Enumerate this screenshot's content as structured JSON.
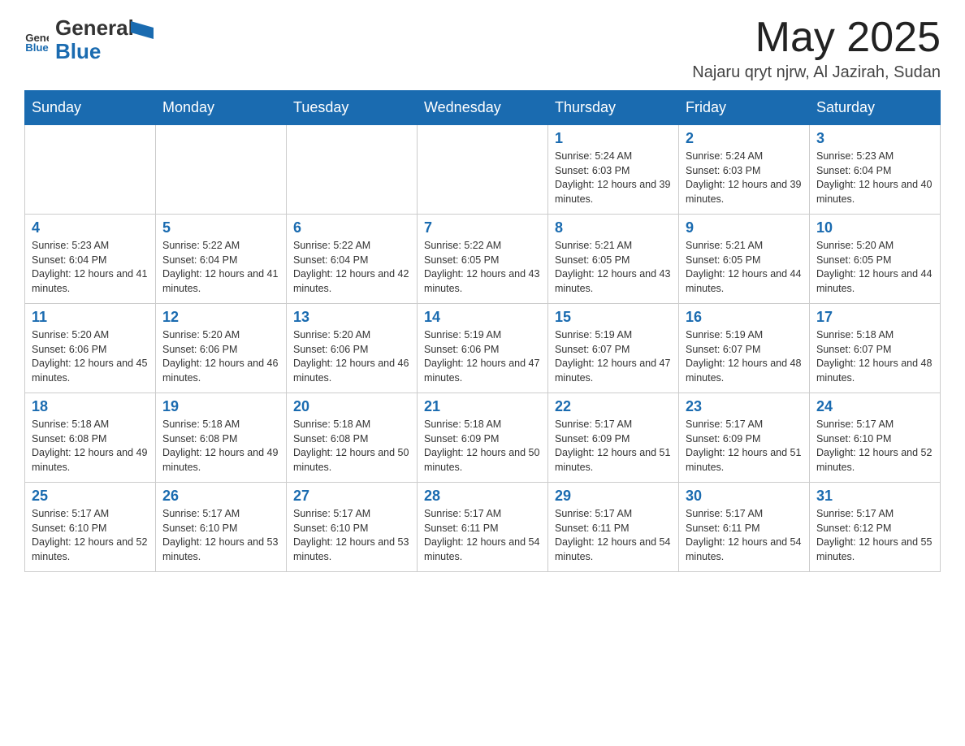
{
  "header": {
    "logo_general": "General",
    "logo_blue": "Blue",
    "month_year": "May 2025",
    "location": "Najaru qryt njrw, Al Jazirah, Sudan"
  },
  "weekdays": [
    "Sunday",
    "Monday",
    "Tuesday",
    "Wednesday",
    "Thursday",
    "Friday",
    "Saturday"
  ],
  "weeks": [
    [
      {
        "day": "",
        "info": ""
      },
      {
        "day": "",
        "info": ""
      },
      {
        "day": "",
        "info": ""
      },
      {
        "day": "",
        "info": ""
      },
      {
        "day": "1",
        "info": "Sunrise: 5:24 AM\nSunset: 6:03 PM\nDaylight: 12 hours and 39 minutes."
      },
      {
        "day": "2",
        "info": "Sunrise: 5:24 AM\nSunset: 6:03 PM\nDaylight: 12 hours and 39 minutes."
      },
      {
        "day": "3",
        "info": "Sunrise: 5:23 AM\nSunset: 6:04 PM\nDaylight: 12 hours and 40 minutes."
      }
    ],
    [
      {
        "day": "4",
        "info": "Sunrise: 5:23 AM\nSunset: 6:04 PM\nDaylight: 12 hours and 41 minutes."
      },
      {
        "day": "5",
        "info": "Sunrise: 5:22 AM\nSunset: 6:04 PM\nDaylight: 12 hours and 41 minutes."
      },
      {
        "day": "6",
        "info": "Sunrise: 5:22 AM\nSunset: 6:04 PM\nDaylight: 12 hours and 42 minutes."
      },
      {
        "day": "7",
        "info": "Sunrise: 5:22 AM\nSunset: 6:05 PM\nDaylight: 12 hours and 43 minutes."
      },
      {
        "day": "8",
        "info": "Sunrise: 5:21 AM\nSunset: 6:05 PM\nDaylight: 12 hours and 43 minutes."
      },
      {
        "day": "9",
        "info": "Sunrise: 5:21 AM\nSunset: 6:05 PM\nDaylight: 12 hours and 44 minutes."
      },
      {
        "day": "10",
        "info": "Sunrise: 5:20 AM\nSunset: 6:05 PM\nDaylight: 12 hours and 44 minutes."
      }
    ],
    [
      {
        "day": "11",
        "info": "Sunrise: 5:20 AM\nSunset: 6:06 PM\nDaylight: 12 hours and 45 minutes."
      },
      {
        "day": "12",
        "info": "Sunrise: 5:20 AM\nSunset: 6:06 PM\nDaylight: 12 hours and 46 minutes."
      },
      {
        "day": "13",
        "info": "Sunrise: 5:20 AM\nSunset: 6:06 PM\nDaylight: 12 hours and 46 minutes."
      },
      {
        "day": "14",
        "info": "Sunrise: 5:19 AM\nSunset: 6:06 PM\nDaylight: 12 hours and 47 minutes."
      },
      {
        "day": "15",
        "info": "Sunrise: 5:19 AM\nSunset: 6:07 PM\nDaylight: 12 hours and 47 minutes."
      },
      {
        "day": "16",
        "info": "Sunrise: 5:19 AM\nSunset: 6:07 PM\nDaylight: 12 hours and 48 minutes."
      },
      {
        "day": "17",
        "info": "Sunrise: 5:18 AM\nSunset: 6:07 PM\nDaylight: 12 hours and 48 minutes."
      }
    ],
    [
      {
        "day": "18",
        "info": "Sunrise: 5:18 AM\nSunset: 6:08 PM\nDaylight: 12 hours and 49 minutes."
      },
      {
        "day": "19",
        "info": "Sunrise: 5:18 AM\nSunset: 6:08 PM\nDaylight: 12 hours and 49 minutes."
      },
      {
        "day": "20",
        "info": "Sunrise: 5:18 AM\nSunset: 6:08 PM\nDaylight: 12 hours and 50 minutes."
      },
      {
        "day": "21",
        "info": "Sunrise: 5:18 AM\nSunset: 6:09 PM\nDaylight: 12 hours and 50 minutes."
      },
      {
        "day": "22",
        "info": "Sunrise: 5:17 AM\nSunset: 6:09 PM\nDaylight: 12 hours and 51 minutes."
      },
      {
        "day": "23",
        "info": "Sunrise: 5:17 AM\nSunset: 6:09 PM\nDaylight: 12 hours and 51 minutes."
      },
      {
        "day": "24",
        "info": "Sunrise: 5:17 AM\nSunset: 6:10 PM\nDaylight: 12 hours and 52 minutes."
      }
    ],
    [
      {
        "day": "25",
        "info": "Sunrise: 5:17 AM\nSunset: 6:10 PM\nDaylight: 12 hours and 52 minutes."
      },
      {
        "day": "26",
        "info": "Sunrise: 5:17 AM\nSunset: 6:10 PM\nDaylight: 12 hours and 53 minutes."
      },
      {
        "day": "27",
        "info": "Sunrise: 5:17 AM\nSunset: 6:10 PM\nDaylight: 12 hours and 53 minutes."
      },
      {
        "day": "28",
        "info": "Sunrise: 5:17 AM\nSunset: 6:11 PM\nDaylight: 12 hours and 54 minutes."
      },
      {
        "day": "29",
        "info": "Sunrise: 5:17 AM\nSunset: 6:11 PM\nDaylight: 12 hours and 54 minutes."
      },
      {
        "day": "30",
        "info": "Sunrise: 5:17 AM\nSunset: 6:11 PM\nDaylight: 12 hours and 54 minutes."
      },
      {
        "day": "31",
        "info": "Sunrise: 5:17 AM\nSunset: 6:12 PM\nDaylight: 12 hours and 55 minutes."
      }
    ]
  ]
}
